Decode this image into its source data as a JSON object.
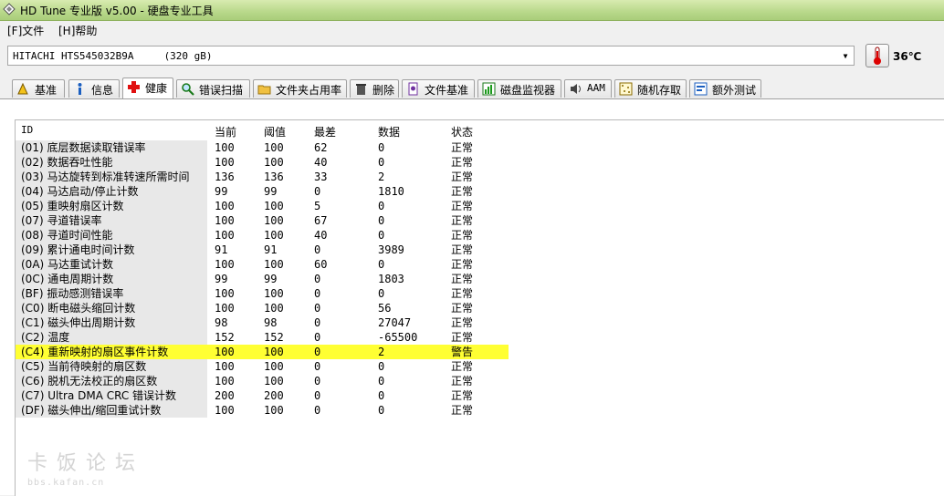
{
  "window": {
    "title": "HD Tune 专业版 v5.00 - 硬盘专业工具"
  },
  "menu": [
    {
      "label": "[F]文件"
    },
    {
      "label": "[H]帮助"
    }
  ],
  "drive": {
    "selected": "HITACHI HTS545032B9A     (320 gB)"
  },
  "temperature": "36℃",
  "tabs": [
    {
      "label": "基准",
      "icon": "benchmark-icon"
    },
    {
      "label": "信息",
      "icon": "info-icon"
    },
    {
      "label": "健康",
      "icon": "health-cross-icon",
      "active": true
    },
    {
      "label": "错误扫描",
      "icon": "magnifier-icon"
    },
    {
      "label": "文件夹占用率",
      "icon": "folder-icon"
    },
    {
      "label": "删除",
      "icon": "trash-icon"
    },
    {
      "label": "文件基准",
      "icon": "file-benchmark-icon"
    },
    {
      "label": "磁盘监视器",
      "icon": "monitor-chart-icon"
    },
    {
      "label": "AAM",
      "icon": "speaker-icon"
    },
    {
      "label": "随机存取",
      "icon": "random-access-icon"
    },
    {
      "label": "额外测试",
      "icon": "extra-tests-icon"
    }
  ],
  "table": {
    "headers": [
      "ID",
      "当前",
      "阈值",
      "最差",
      "数据",
      "状态"
    ],
    "rows": [
      [
        "(01) 底层数据读取错误率",
        "100",
        "100",
        "62",
        "0",
        "正常"
      ],
      [
        "(02) 数据吞吐性能",
        "100",
        "100",
        "40",
        "0",
        "正常"
      ],
      [
        "(03) 马达旋转到标准转速所需时间",
        "136",
        "136",
        "33",
        "2",
        "正常"
      ],
      [
        "(04) 马达启动/停止计数",
        "99",
        "99",
        "0",
        "1810",
        "正常"
      ],
      [
        "(05) 重映射扇区计数",
        "100",
        "100",
        "5",
        "0",
        "正常"
      ],
      [
        "(07) 寻道错误率",
        "100",
        "100",
        "67",
        "0",
        "正常"
      ],
      [
        "(08) 寻道时间性能",
        "100",
        "100",
        "40",
        "0",
        "正常"
      ],
      [
        "(09) 累计通电时间计数",
        "91",
        "91",
        "0",
        "3989",
        "正常"
      ],
      [
        "(0A) 马达重试计数",
        "100",
        "100",
        "60",
        "0",
        "正常"
      ],
      [
        "(0C) 通电周期计数",
        "99",
        "99",
        "0",
        "1803",
        "正常"
      ],
      [
        "(BF) 振动感测错误率",
        "100",
        "100",
        "0",
        "0",
        "正常"
      ],
      [
        "(C0) 断电磁头缩回计数",
        "100",
        "100",
        "0",
        "56",
        "正常"
      ],
      [
        "(C1) 磁头伸出周期计数",
        "98",
        "98",
        "0",
        "27047",
        "正常"
      ],
      [
        "(C2) 温度",
        "152",
        "152",
        "0",
        "-65500",
        "正常"
      ],
      [
        "(C4) 重新映射的扇区事件计数",
        "100",
        "100",
        "0",
        "2",
        "警告"
      ],
      [
        "(C5) 当前待映射的扇区数",
        "100",
        "100",
        "0",
        "0",
        "正常"
      ],
      [
        "(C6) 脱机无法校正的扇区数",
        "100",
        "100",
        "0",
        "0",
        "正常"
      ],
      [
        "(C7) Ultra DMA CRC 错误计数",
        "200",
        "200",
        "0",
        "0",
        "正常"
      ],
      [
        "(DF) 磁头伸出/缩回重试计数",
        "100",
        "100",
        "0",
        "0",
        "正常"
      ]
    ],
    "highlight_color": "#ffff33"
  },
  "watermark": {
    "line1": "卡饭论坛",
    "line2": "bbs.kafan.cn"
  }
}
